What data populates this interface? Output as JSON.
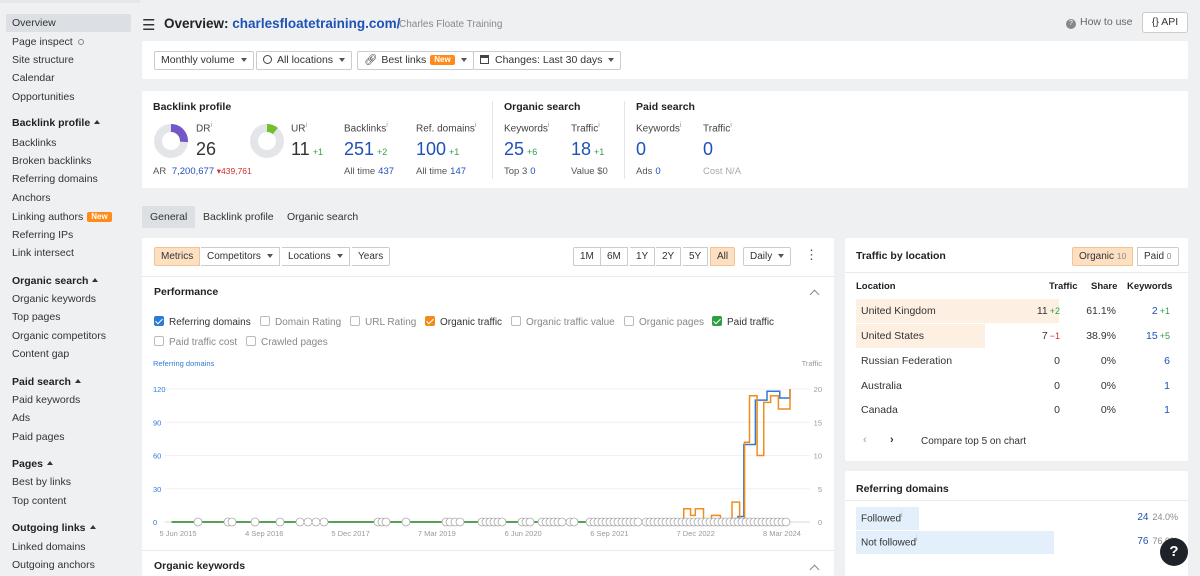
{
  "sidebar": {
    "items": [
      {
        "label": "Overview",
        "active": true
      },
      {
        "label": "Page inspect",
        "icon": "search-icon"
      },
      {
        "label": "Site structure"
      },
      {
        "label": "Calendar"
      },
      {
        "label": "Opportunities"
      },
      {
        "label": "Backlink profile",
        "head": true
      },
      {
        "label": "Backlinks"
      },
      {
        "label": "Broken backlinks"
      },
      {
        "label": "Referring domains"
      },
      {
        "label": "Anchors"
      },
      {
        "label": "Linking authors",
        "badge": "New"
      },
      {
        "label": "Referring IPs"
      },
      {
        "label": "Link intersect"
      },
      {
        "label": "Organic search",
        "head": true
      },
      {
        "label": "Organic keywords"
      },
      {
        "label": "Top pages"
      },
      {
        "label": "Organic competitors"
      },
      {
        "label": "Content gap"
      },
      {
        "label": "Paid search",
        "head": true
      },
      {
        "label": "Paid keywords"
      },
      {
        "label": "Ads"
      },
      {
        "label": "Paid pages"
      },
      {
        "label": "Pages",
        "head": true
      },
      {
        "label": "Best by links"
      },
      {
        "label": "Top content"
      },
      {
        "label": "Outgoing links",
        "head": true
      },
      {
        "label": "Linked domains"
      },
      {
        "label": "Outgoing anchors"
      }
    ]
  },
  "header": {
    "title_prefix": "Overview: ",
    "domain": "charlesfloatetraining.com/",
    "site_name": "Charles Floate Training",
    "how_to": "How to use",
    "api": "{} API"
  },
  "filters": {
    "volume": "Monthly volume",
    "locations": "All locations",
    "best_links": "Best links",
    "best_links_badge": "New",
    "changes": "Changes: Last 30 days"
  },
  "backlink_profile": {
    "title": "Backlink profile",
    "dr_label": "DR",
    "dr_value": "26",
    "dr_fraction": 0.26,
    "ar_label": "AR",
    "ar_value": "7,200,677",
    "ar_delta": "439,761",
    "ur_label": "UR",
    "ur_value": "11",
    "ur_delta": "+1",
    "ur_fraction": 0.11,
    "backlinks_label": "Backlinks",
    "backlinks_value": "251",
    "backlinks_delta": "+2",
    "backlinks_alltime_label": "All time",
    "backlinks_alltime": "437",
    "refdomains_label": "Ref. domains",
    "refdomains_value": "100",
    "refdomains_delta": "+1",
    "refdomains_alltime_label": "All time",
    "refdomains_alltime": "147"
  },
  "organic": {
    "title": "Organic search",
    "keywords_label": "Keywords",
    "keywords_value": "25",
    "keywords_delta": "+6",
    "top3_label": "Top 3",
    "top3_value": "0",
    "traffic_label": "Traffic",
    "traffic_value": "18",
    "traffic_delta": "+1",
    "value_label": "Value",
    "value_value": "$0"
  },
  "paid": {
    "title": "Paid search",
    "keywords_label": "Keywords",
    "keywords_value": "0",
    "ads_label": "Ads",
    "ads_value": "0",
    "traffic_label": "Traffic",
    "traffic_value": "0",
    "cost_label": "Cost",
    "cost_value": "N/A"
  },
  "tabs": [
    "General",
    "Backlink profile",
    "Organic search"
  ],
  "chart_controls": {
    "metric_tabs": [
      "Metrics",
      "Competitors",
      "Locations",
      "Years"
    ],
    "ranges": [
      "1M",
      "6M",
      "1Y",
      "2Y",
      "5Y",
      "All"
    ],
    "interval": "Daily",
    "performance_title": "Performance",
    "checkboxes": [
      {
        "label": "Referring domains",
        "checked": true,
        "color": "#2e7bd6"
      },
      {
        "label": "Domain Rating",
        "checked": false
      },
      {
        "label": "URL Rating",
        "checked": false
      },
      {
        "label": "Organic traffic",
        "checked": true,
        "color": "#f08c1a"
      },
      {
        "label": "Organic traffic value",
        "checked": false
      },
      {
        "label": "Organic pages",
        "checked": false
      },
      {
        "label": "Paid traffic",
        "checked": true,
        "color": "#2f9e44"
      },
      {
        "label": "Paid traffic cost",
        "checked": false
      },
      {
        "label": "Crawled pages",
        "checked": false
      }
    ],
    "organic_keywords_title": "Organic keywords"
  },
  "chart_data": {
    "type": "line",
    "xlabel": "",
    "left_axis_label": "Referring domains",
    "right_axis_label": "Traffic",
    "left_ticks": [
      0,
      30,
      60,
      90,
      120
    ],
    "right_ticks": [
      0,
      5,
      10,
      15,
      20
    ],
    "x_ticks": [
      "5 Jun 2015",
      "4 Sep 2016",
      "5 Dec 2017",
      "7 Mar 2019",
      "6 Jun 2020",
      "6 Sep 2021",
      "7 Dec 2022",
      "8 Mar 2024"
    ],
    "series": [
      {
        "name": "Referring domains",
        "axis": "left",
        "color": "#2e7bd6",
        "x": [
          "2015-06-05",
          "2022-12-07",
          "2023-04-01",
          "2023-06-15",
          "2023-08-01",
          "2023-09-01",
          "2023-11-01",
          "2024-01-01",
          "2024-03-08",
          "2024-05-01"
        ],
        "y": [
          0,
          0,
          2,
          3,
          5,
          70,
          110,
          118,
          112,
          120
        ]
      },
      {
        "name": "Organic traffic",
        "axis": "right",
        "color": "#f08c1a",
        "x": [
          "2015-06-05",
          "2022-10-01",
          "2022-10-20",
          "2022-11-25",
          "2022-12-20",
          "2023-02-01",
          "2023-03-15",
          "2023-05-01",
          "2023-07-01",
          "2023-08-10",
          "2023-09-05",
          "2023-10-01",
          "2023-11-10",
          "2023-12-15",
          "2024-01-20",
          "2024-03-01",
          "2024-05-01"
        ],
        "y": [
          0,
          0,
          2,
          1,
          2,
          0,
          1,
          0,
          3,
          0,
          12,
          19,
          10,
          18,
          19,
          17,
          20
        ]
      },
      {
        "name": "Paid traffic",
        "axis": "right",
        "color": "#2f9e44",
        "x": [
          "2015-06-05",
          "2024-05-01"
        ],
        "y": [
          0,
          0
        ]
      }
    ],
    "xlim": [
      "2015-05-01",
      "2024-05-01"
    ],
    "ylim_left": [
      0,
      130
    ],
    "ylim_right": [
      0,
      21.67
    ]
  },
  "traffic_by_location": {
    "title": "Traffic by location",
    "toggle_organic": "Organic",
    "toggle_organic_count": "10",
    "toggle_paid": "Paid",
    "toggle_paid_count": "0",
    "headers": [
      "Location",
      "Traffic",
      "Share",
      "Keywords"
    ],
    "rows": [
      {
        "location": "United Kingdom",
        "traffic": "11",
        "traffic_delta": "+2",
        "share": "61.1%",
        "share_fraction": 0.611,
        "keywords": "2",
        "keywords_delta": "+1"
      },
      {
        "location": "United States",
        "traffic": "7",
        "traffic_delta": "−1",
        "share": "38.9%",
        "share_fraction": 0.389,
        "keywords": "15",
        "keywords_delta": "+5"
      },
      {
        "location": "Russian Federation",
        "traffic": "0",
        "traffic_delta": "",
        "share": "0%",
        "share_fraction": 0,
        "keywords": "6",
        "keywords_delta": ""
      },
      {
        "location": "Australia",
        "traffic": "0",
        "traffic_delta": "",
        "share": "0%",
        "share_fraction": 0,
        "keywords": "1",
        "keywords_delta": ""
      },
      {
        "location": "Canada",
        "traffic": "0",
        "traffic_delta": "",
        "share": "0%",
        "share_fraction": 0,
        "keywords": "1",
        "keywords_delta": ""
      }
    ],
    "compare": "Compare top 5 on chart"
  },
  "referring_domains": {
    "title": "Referring domains",
    "rows": [
      {
        "label": "Followed",
        "value": "24",
        "percent": "24.0%",
        "fraction": 0.24
      },
      {
        "label": "Not followed",
        "value": "76",
        "percent": "76.0%",
        "fraction": 0.76
      }
    ]
  },
  "help": "?"
}
